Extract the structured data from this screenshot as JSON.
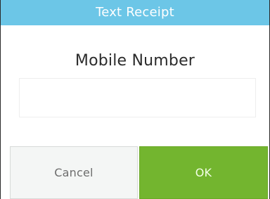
{
  "dialog": {
    "title": "Text Receipt",
    "field_label": "Mobile Number",
    "input": {
      "value": "",
      "placeholder": ""
    },
    "buttons": {
      "cancel_label": "Cancel",
      "ok_label": "OK"
    }
  },
  "colors": {
    "header_bg": "#6cc6e7",
    "ok_bg": "#73b52f",
    "cancel_bg": "#f4f6f5"
  }
}
